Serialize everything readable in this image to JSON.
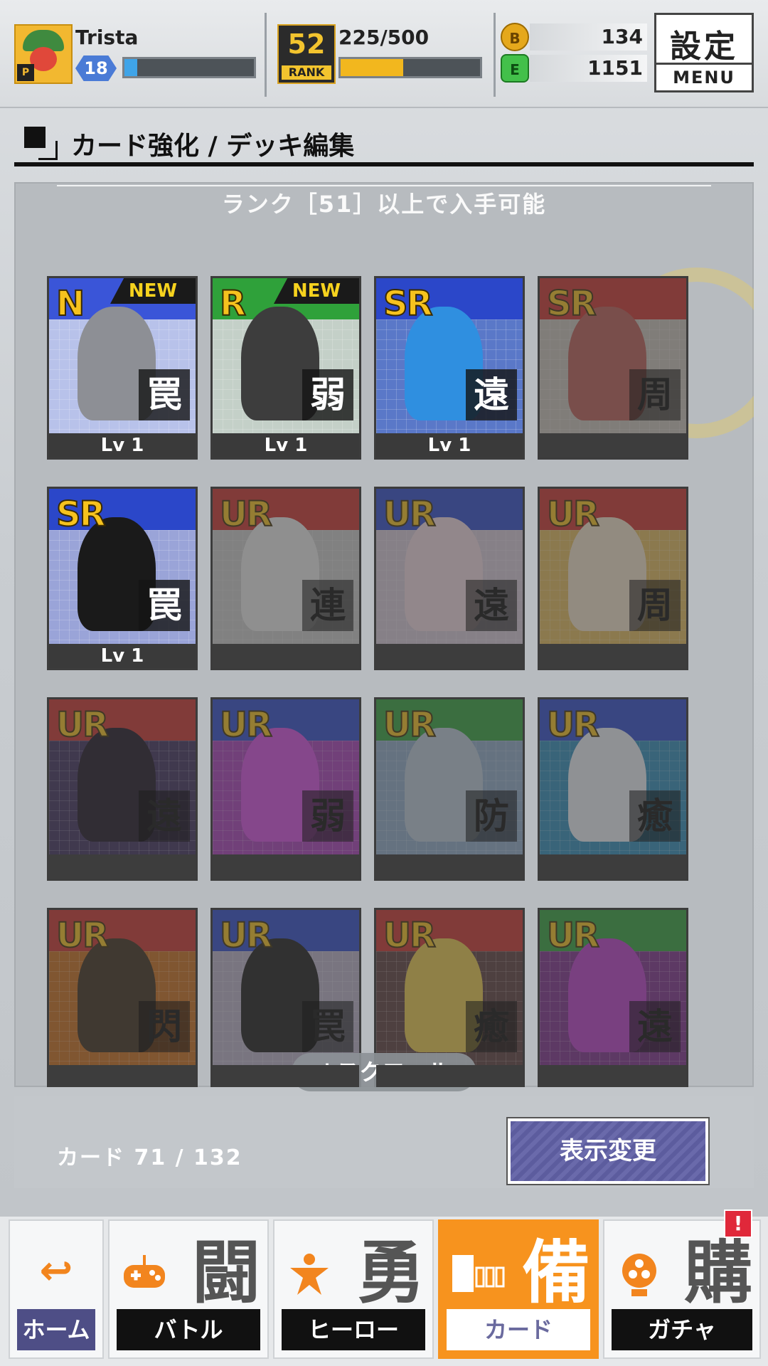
{
  "player": {
    "name": "Trista",
    "level": "18",
    "level_progress": 0.1
  },
  "rank": {
    "value": "52",
    "label": "RANK",
    "exp_text": "225/500",
    "exp_progress": 0.45
  },
  "currency": {
    "gold": "134",
    "energy": "1151",
    "gold_icon_glyph": "B",
    "energy_icon_glyph": "E"
  },
  "menu": {
    "kanji": "設定",
    "label": "MENU"
  },
  "section": {
    "title": "カード強化 / デッキ編集"
  },
  "panel": {
    "rank_note": "ランク［51］以上で入手可能"
  },
  "cards": [
    {
      "rarity": "N",
      "type": "罠",
      "level": "Lv 1",
      "new_tag": "NEW",
      "locked": false,
      "stripe": "#3a55d8",
      "bg": "#b8c2ea",
      "figure": "#8d8f95"
    },
    {
      "rarity": "R",
      "type": "弱",
      "level": "Lv 1",
      "new_tag": "NEW",
      "locked": false,
      "stripe": "#2fa13a",
      "bg": "#c4d0c8",
      "figure": "#3d3d3d"
    },
    {
      "rarity": "SR",
      "type": "遠",
      "level": "Lv 1",
      "new_tag": "",
      "locked": false,
      "stripe": "#2b47c9",
      "bg": "#5a78c8",
      "figure": "#2f8fe0"
    },
    {
      "rarity": "SR",
      "type": "周",
      "level": "",
      "new_tag": "",
      "locked": true,
      "stripe": "#c9302c",
      "bg": "#c8c0b8",
      "figure": "#b85a52"
    },
    {
      "rarity": "SR",
      "type": "罠",
      "level": "Lv 1",
      "new_tag": "",
      "locked": false,
      "stripe": "#2b47c9",
      "bg": "#9aa4d8",
      "figure": "#1a1a1a"
    },
    {
      "rarity": "UR",
      "type": "連",
      "level": "",
      "new_tag": "",
      "locked": true,
      "stripe": "#c9302c",
      "bg": "#c9c9c9",
      "figure": "#e8e8e8"
    },
    {
      "rarity": "UR",
      "type": "遠",
      "level": "",
      "new_tag": "",
      "locked": true,
      "stripe": "#2b47c9",
      "bg": "#d6c8d8",
      "figure": "#f0d8e0"
    },
    {
      "rarity": "UR",
      "type": "周",
      "level": "",
      "new_tag": "",
      "locked": true,
      "stripe": "#c9302c",
      "bg": "#e0b85a",
      "figure": "#f0e0c8"
    },
    {
      "rarity": "UR",
      "type": "遠",
      "level": "",
      "new_tag": "",
      "locked": true,
      "stripe": "#c9302c",
      "bg": "#3a2a5a",
      "figure": "#1a1020"
    },
    {
      "rarity": "UR",
      "type": "弱",
      "level": "",
      "new_tag": "",
      "locked": true,
      "stripe": "#2b47c9",
      "bg": "#a63bb8",
      "figure": "#d24ae0"
    },
    {
      "rarity": "UR",
      "type": "防",
      "level": "",
      "new_tag": "",
      "locked": true,
      "stripe": "#2fa13a",
      "bg": "#8ca8c8",
      "figure": "#b8c8d8"
    },
    {
      "rarity": "UR",
      "type": "癒",
      "level": "",
      "new_tag": "",
      "locked": true,
      "stripe": "#2b47c9",
      "bg": "#2a8ab8",
      "figure": "#e8eef4"
    },
    {
      "rarity": "UR",
      "type": "閃",
      "level": "",
      "new_tag": "",
      "locked": true,
      "stripe": "#c9302c",
      "bg": "#c86a1a",
      "figure": "#3a2a1a"
    },
    {
      "rarity": "UR",
      "type": "罠",
      "level": "",
      "new_tag": "",
      "locked": true,
      "stripe": "#2b47c9",
      "bg": "#b8b0c8",
      "figure": "#1a1a1a"
    },
    {
      "rarity": "UR",
      "type": "癒",
      "level": "",
      "new_tag": "",
      "locked": true,
      "stripe": "#c9302c",
      "bg": "#5a3a3a",
      "figure": "#e8c84a"
    },
    {
      "rarity": "UR",
      "type": "遠",
      "level": "",
      "new_tag": "",
      "locked": true,
      "stripe": "#2fa13a",
      "bg": "#7a2a8a",
      "figure": "#b83ac8"
    }
  ],
  "scroll_hint": "↓スクロール",
  "footer": {
    "card_count": "カード 71 / 132",
    "view_button": "表示変更"
  },
  "nav": [
    {
      "key": "home",
      "kanji": "",
      "label": "ホーム",
      "icon": "return-arrow-icon",
      "glyph": "↩"
    },
    {
      "key": "battle",
      "kanji": "闘",
      "label": "バトル",
      "icon": "gamepad-icon",
      "glyph": "🎮"
    },
    {
      "key": "hero",
      "kanji": "勇",
      "label": "ヒーロー",
      "icon": "hero-icon",
      "glyph": "✶"
    },
    {
      "key": "card",
      "kanji": "備",
      "label": "カード",
      "icon": "card-icon",
      "glyph": "▯"
    },
    {
      "key": "gacha",
      "kanji": "購",
      "label": "ガチャ",
      "icon": "gacha-icon",
      "glyph": "✿"
    }
  ],
  "gacha_alert": "!"
}
